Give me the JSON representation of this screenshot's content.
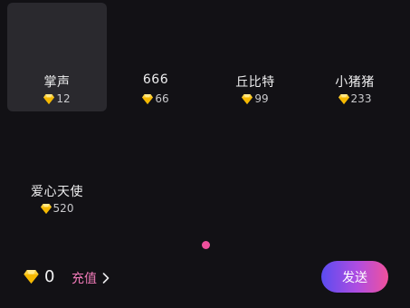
{
  "gifts": [
    {
      "name": "掌声",
      "price": "12",
      "selected": true
    },
    {
      "name": "666",
      "price": "66",
      "selected": false
    },
    {
      "name": "丘比特",
      "price": "99",
      "selected": false
    },
    {
      "name": "小猪猪",
      "price": "233",
      "selected": false
    },
    {
      "name": "爱心天使",
      "price": "520",
      "selected": false
    }
  ],
  "currency_icon": "diamond-gem-icon",
  "pager": {
    "current_page": 1
  },
  "wallet": {
    "balance": "0",
    "recharge_label": "充值"
  },
  "send_label": "发送",
  "colors": {
    "background": "#121115",
    "selected_tile": "#2a292e",
    "gem": "#ffd23f",
    "recharge": "#f07ab8",
    "page_dot": "#ee4f9c",
    "send_gradient": [
      "#5b4cf0",
      "#b14de0",
      "#f0519c"
    ]
  }
}
